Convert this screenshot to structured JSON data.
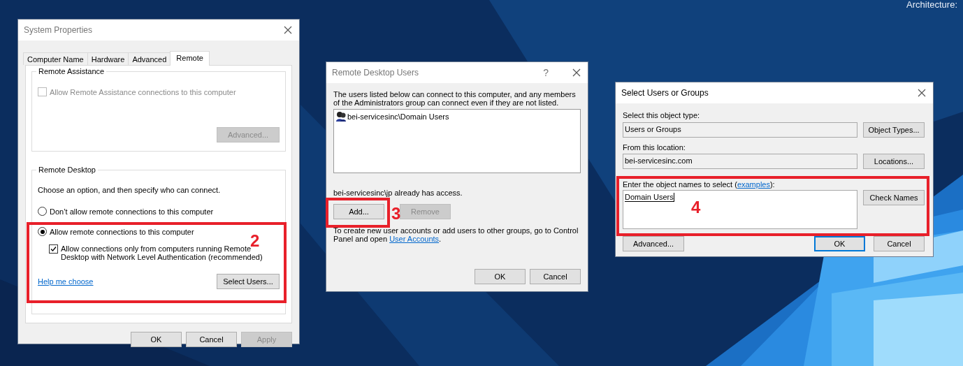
{
  "desktop": {
    "corner_text": "Architecture:"
  },
  "system_properties": {
    "title": "System Properties",
    "tabs": [
      {
        "label": "Computer Name",
        "selected": false
      },
      {
        "label": "Hardware",
        "selected": false
      },
      {
        "label": "Advanced",
        "selected": false
      },
      {
        "label": "Remote",
        "selected": true
      }
    ],
    "remote_assistance": {
      "heading": "Remote Assistance",
      "checkbox": {
        "label": "Allow Remote Assistance connections to this computer",
        "checked": false,
        "disabled": true
      },
      "advanced_button": {
        "label": "Advanced...",
        "disabled": true
      }
    },
    "remote_desktop": {
      "heading": "Remote Desktop",
      "instruction": "Choose an option, and then specify who can connect.",
      "options": [
        {
          "label": "Don’t allow remote connections to this computer",
          "selected": false
        },
        {
          "label": "Allow remote connections to this computer",
          "selected": true
        }
      ],
      "nla_checkbox": {
        "label": "Allow connections only from computers running Remote Desktop with Network Level Authentication (recommended)",
        "checked": true,
        "disabled": false
      },
      "help_link": "Help me choose",
      "select_users_button": {
        "label": "Select Users...",
        "disabled": false
      }
    },
    "buttons": [
      {
        "label": "OK",
        "disabled": false
      },
      {
        "label": "Cancel",
        "disabled": false
      },
      {
        "label": "Apply",
        "disabled": true
      }
    ]
  },
  "remote_desktop_users": {
    "title": "Remote Desktop Users",
    "help_glyph": "?",
    "description": "The users listed below can connect to this computer, and any members of the Administrators group can connect even if they are not listed.",
    "users": [
      {
        "name": "bei-servicesinc\\Domain Users"
      }
    ],
    "access_note": "bei-servicesinc\\jp already has access.",
    "buttons": [
      {
        "label": "Add...",
        "disabled": false
      },
      {
        "label": "Remove",
        "disabled": true
      }
    ],
    "footer_text": "To create new user accounts or add users to other groups, go to Control Panel and open ",
    "footer_link": "User Accounts",
    "footer_end": ".",
    "dialog_buttons": [
      {
        "label": "OK",
        "disabled": false
      },
      {
        "label": "Cancel",
        "disabled": false
      }
    ]
  },
  "select_users": {
    "title": "Select Users or Groups",
    "object_type_label": "Select this object type:",
    "object_type": "Users or Groups",
    "object_types_button": "Object Types...",
    "location_label": "From this location:",
    "location": "bei-servicesinc.com",
    "locations_button": "Locations...",
    "names_label": "Enter the object names to select (",
    "names_link": "examples",
    "names_label_end": "):",
    "names_value": "Domain Users",
    "check_names_button": "Check Names",
    "advanced_button": "Advanced...",
    "dialog_buttons": [
      {
        "label": "OK",
        "disabled": false
      },
      {
        "label": "Cancel",
        "disabled": false
      }
    ]
  },
  "annotations": [
    {
      "label": "2"
    },
    {
      "label": "3"
    },
    {
      "label": "4"
    }
  ]
}
